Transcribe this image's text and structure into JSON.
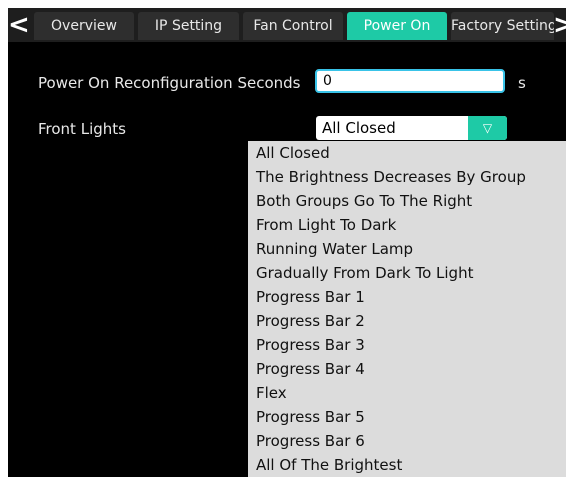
{
  "tabs": {
    "prev": "<",
    "next": ">",
    "items": [
      "Overview",
      "IP Setting",
      "Fan Control",
      "Power On",
      "Factory Setting"
    ],
    "active": "Power On"
  },
  "form": {
    "reconfig_label": "Power On Reconfiguration Seconds",
    "reconfig_value": "0",
    "reconfig_unit": "s",
    "front_lights_label": "Front Lights",
    "front_lights_value": "All Closed",
    "dropdown_arrow": "▽"
  },
  "dropdown_options": [
    "All Closed",
    "The Brightness Decreases By Group",
    "Both Groups Go To The Right",
    "From Light To Dark",
    "Running Water Lamp",
    "Gradually From Dark To Light",
    "Progress Bar 1",
    "Progress Bar 2",
    "Progress Bar 3",
    "Progress Bar 4",
    "Flex",
    "Progress Bar 5",
    "Progress Bar 6",
    "All Of The Brightest"
  ],
  "colors": {
    "accent": "#1ecaa6",
    "background": "#000000",
    "tab_bg": "#2e2e2e",
    "dropdown_bg": "#dcdcdc"
  }
}
